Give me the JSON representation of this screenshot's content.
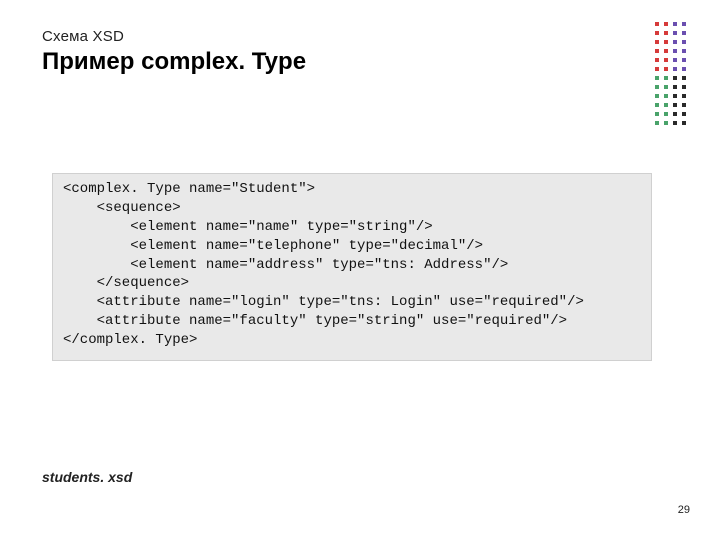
{
  "header": {
    "subtitle": "Схема XSD",
    "title": "Пример complex. Type"
  },
  "code": {
    "line1": "<complex. Type name=\"Student\">",
    "line2": "    <sequence>",
    "line3": "        <element name=\"name\" type=\"string\"/>",
    "line4": "        <element name=\"telephone\" type=\"decimal\"/>",
    "line5": "        <element name=\"address\" type=\"tns: Address\"/>",
    "line6": "    </sequence>",
    "line7": "    <attribute name=\"login\" type=\"tns: Login\" use=\"required\"/>",
    "line8": "    <attribute name=\"faculty\" type=\"string\" use=\"required\"/>",
    "line9": "</complex. Type>"
  },
  "footer": {
    "filename": "students. xsd",
    "page_number": "29"
  }
}
